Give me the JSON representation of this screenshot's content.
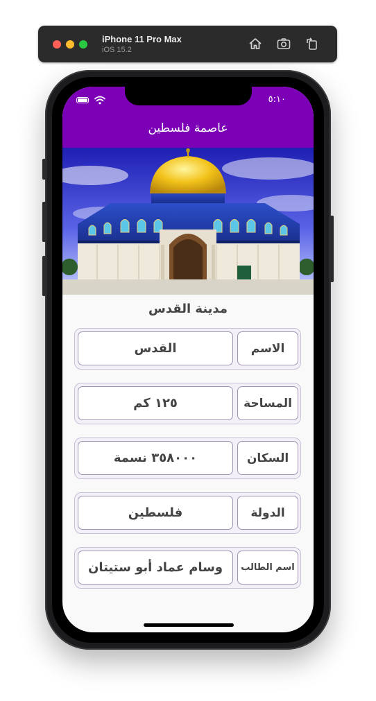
{
  "simulator": {
    "device_name": "iPhone 11 Pro Max",
    "os_version": "iOS 15.2",
    "buttons": [
      "home-icon",
      "screenshot-icon",
      "rotate-icon"
    ]
  },
  "status_bar": {
    "time": "٥:١٠",
    "icons": [
      "battery-icon",
      "wifi-icon"
    ]
  },
  "app_bar": {
    "title": "عاصمة فلسطين",
    "color": "#7b00b6"
  },
  "hero_image": {
    "description_icon": "dome-of-the-rock-image"
  },
  "content": {
    "city_title": "مدينة القدس",
    "rows": [
      {
        "label": "الاسم",
        "value": "القدس"
      },
      {
        "label": "المساحة",
        "value": "١٢٥ كم"
      },
      {
        "label": "السكان",
        "value": "٣٥٨٠٠٠ نسمة"
      },
      {
        "label": "الدولة",
        "value": "فلسطين"
      },
      {
        "label": "اسم الطالب",
        "value": "وسام عماد أبو ستيتان"
      }
    ]
  }
}
